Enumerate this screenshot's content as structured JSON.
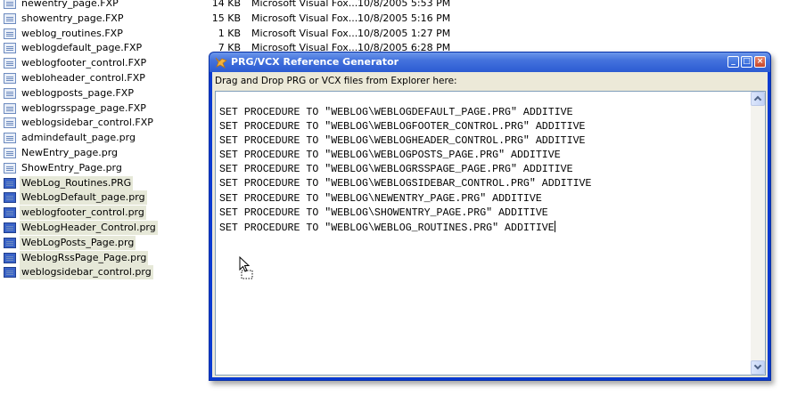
{
  "explorer": {
    "files": [
      {
        "name": "newentry_page.FXP",
        "size": "14 KB",
        "type": "Microsoft Visual Fox...",
        "date": "10/8/2005 5:53 PM",
        "selected": false
      },
      {
        "name": "showentry_page.FXP",
        "size": "15 KB",
        "type": "Microsoft Visual Fox...",
        "date": "10/8/2005 5:16 PM",
        "selected": false
      },
      {
        "name": "weblog_routines.FXP",
        "size": "1 KB",
        "type": "Microsoft Visual Fox...",
        "date": "10/8/2005 1:27 PM",
        "selected": false
      },
      {
        "name": "weblogdefault_page.FXP",
        "size": "7 KB",
        "type": "Microsoft Visual Fox...",
        "date": "10/8/2005 6:28 PM",
        "selected": false
      },
      {
        "name": "weblogfooter_control.FXP",
        "size": "",
        "type": "",
        "date": "",
        "selected": false
      },
      {
        "name": "webloheader_control.FXP",
        "size": "",
        "type": "",
        "date": "",
        "selected": false
      },
      {
        "name": "weblogposts_page.FXP",
        "size": "",
        "type": "",
        "date": "",
        "selected": false
      },
      {
        "name": "weblogrsspage_page.FXP",
        "size": "",
        "type": "",
        "date": "",
        "selected": false
      },
      {
        "name": "weblogsidebar_control.FXP",
        "size": "",
        "type": "",
        "date": "",
        "selected": false
      },
      {
        "name": "admindefault_page.prg",
        "size": "",
        "type": "",
        "date": "",
        "selected": false
      },
      {
        "name": "NewEntry_page.prg",
        "size": "",
        "type": "",
        "date": "",
        "selected": false
      },
      {
        "name": "ShowEntry_Page.prg",
        "size": "",
        "type": "",
        "date": "",
        "selected": false
      },
      {
        "name": "WebLog_Routines.PRG",
        "size": "",
        "type": "",
        "date": "",
        "selected": true
      },
      {
        "name": "WebLogDefault_page.prg",
        "size": "",
        "type": "",
        "date": "",
        "selected": true
      },
      {
        "name": "weblogfooter_control.prg",
        "size": "",
        "type": "",
        "date": "",
        "selected": true
      },
      {
        "name": "WebLogHeader_Control.prg",
        "size": "",
        "type": "",
        "date": "",
        "selected": true
      },
      {
        "name": "WebLogPosts_Page.prg",
        "size": "",
        "type": "",
        "date": "",
        "selected": true
      },
      {
        "name": "WeblogRssPage_Page.prg",
        "size": "",
        "type": "",
        "date": "",
        "selected": true
      },
      {
        "name": "weblogsidebar_control.prg",
        "size": "",
        "type": "",
        "date": "",
        "selected": true
      }
    ]
  },
  "window": {
    "title": "PRG/VCX Reference Generator",
    "minimize_symbol": "_",
    "maximize_symbol": "□",
    "close_symbol": "×",
    "prompt": "Drag and Drop PRG or VCX files from Explorer here:",
    "code_lines": [
      "SET PROCEDURE TO \"WEBLOG\\WEBLOGDEFAULT_PAGE.PRG\" ADDITIVE",
      "SET PROCEDURE TO \"WEBLOG\\WEBLOGFOOTER_CONTROL.PRG\" ADDITIVE",
      "SET PROCEDURE TO \"WEBLOG\\WEBLOGHEADER_CONTROL.PRG\" ADDITIVE",
      "SET PROCEDURE TO \"WEBLOG\\WEBLOGPOSTS_PAGE.PRG\" ADDITIVE",
      "SET PROCEDURE TO \"WEBLOG\\WEBLOGRSSPAGE_PAGE.PRG\" ADDITIVE",
      "SET PROCEDURE TO \"WEBLOG\\WEBLOGSIDEBAR_CONTROL.PRG\" ADDITIVE",
      "SET PROCEDURE TO \"WEBLOG\\NEWENTRY_PAGE.PRG\" ADDITIVE",
      "SET PROCEDURE TO \"WEBLOG\\SHOWENTRY_PAGE.PRG\" ADDITIVE",
      "SET PROCEDURE TO \"WEBLOG\\WEBLOG_ROUTINES.PRG\" ADDITIVE"
    ]
  },
  "colors": {
    "titlebar": "#2b5bd2",
    "selection_highlight": "#e6e8d8",
    "client_background": "#ece9d8"
  }
}
